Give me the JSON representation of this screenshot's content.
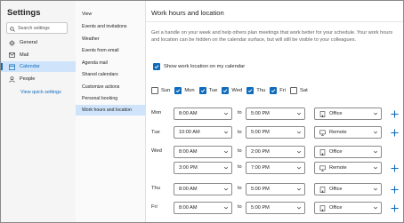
{
  "sidebar": {
    "title": "Settings",
    "search_placeholder": "Search settings",
    "items": [
      {
        "label": "General",
        "icon": "gear-icon"
      },
      {
        "label": "Mail",
        "icon": "mail-icon"
      },
      {
        "label": "Calendar",
        "icon": "calendar-icon",
        "active": true
      },
      {
        "label": "People",
        "icon": "people-icon"
      }
    ],
    "quick_settings_link": "View quick settings"
  },
  "subnav": {
    "items": [
      "View",
      "Events and invitations",
      "Weather",
      "Events from email",
      "Agenda mail",
      "Shared calendars",
      "Customize actions",
      "Personal booking",
      "Work hours and location"
    ],
    "active": "Work hours and location"
  },
  "main": {
    "title": "Work hours and location",
    "description": "Get a handle on your week and help others plan meetings that work better for your schedule. Your work hours and location can be hidden on the calendar surface, but will still be visible to your colleagues.",
    "show_location_label": "Show work location on my calendar",
    "show_location_checked": true,
    "days": [
      {
        "label": "Sun",
        "checked": false
      },
      {
        "label": "Mon",
        "checked": true
      },
      {
        "label": "Tue",
        "checked": true
      },
      {
        "label": "Wed",
        "checked": true
      },
      {
        "label": "Thu",
        "checked": true
      },
      {
        "label": "Fri",
        "checked": true
      },
      {
        "label": "Sat",
        "checked": false
      }
    ],
    "to_label": "to",
    "schedule": [
      {
        "day": "Mon",
        "start": "8:00 AM",
        "end": "5:00 PM",
        "location": "Office",
        "location_icon": "building-icon"
      },
      {
        "day": "Tue",
        "start": "10:00 AM",
        "end": "5:00 PM",
        "location": "Remote",
        "location_icon": "monitor-icon"
      },
      {
        "day": "Wed",
        "start": "8:00 AM",
        "end": "2:00 PM",
        "location": "Office",
        "location_icon": "building-icon"
      },
      {
        "day": "",
        "start": "3:00 PM",
        "end": "7:00 PM",
        "location": "Remote",
        "location_icon": "monitor-icon"
      },
      {
        "day": "Thu",
        "start": "8:00 AM",
        "end": "5:00 PM",
        "location": "Office",
        "location_icon": "building-icon"
      },
      {
        "day": "Fri",
        "start": "8:00 AM",
        "end": "5:00 PM",
        "location": "Office",
        "location_icon": "building-icon"
      }
    ]
  },
  "colors": {
    "accent": "#0f6cbd",
    "selected_bg": "#cfe4fa"
  }
}
